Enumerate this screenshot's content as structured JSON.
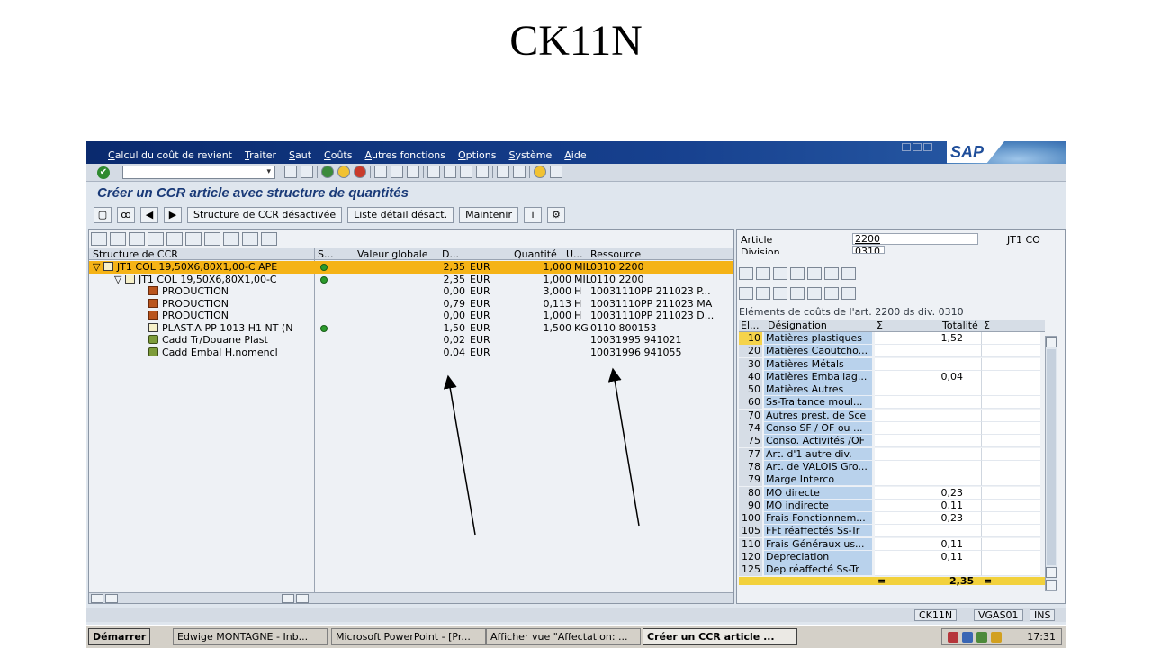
{
  "slide": {
    "title": "CK11N"
  },
  "window": {
    "menu": [
      "Calcul du coût de revient",
      "Traiter",
      "Saut",
      "Coûts",
      "Autres fonctions",
      "Options",
      "Système",
      "Aide"
    ],
    "logo": "SAP"
  },
  "screen_title": "Créer un CCR article avec structure de quantités",
  "app_toolbar": {
    "struct_off": "Structure de CCR désactivée",
    "detail_list_off": "Liste détail désact.",
    "maintain": "Maintenir"
  },
  "tree": {
    "headers": {
      "structure": "Structure de CCR",
      "status": "S...",
      "value": "Valeur globale",
      "currency": "D...",
      "quantity": "Quantité",
      "unit": "U...",
      "resource": "Ressource"
    },
    "rows": [
      {
        "name": "JT1 COL  19,50X6,80X1,00-C  APE",
        "status": true,
        "value": "2,35",
        "cur": "EUR",
        "qty": "1,000",
        "unit": "MIL",
        "res": "0310 2200",
        "level": 0,
        "icon": "assembly",
        "selected": true
      },
      {
        "name": "JT1 COL  19,50X6,80X1,00-C",
        "status": true,
        "value": "2,35",
        "cur": "EUR",
        "qty": "1,000",
        "unit": "MIL",
        "res": "0110 2200",
        "level": 1,
        "icon": "assembly",
        "selected": false
      },
      {
        "name": "PRODUCTION",
        "status": false,
        "value": "0,00",
        "cur": "EUR",
        "qty": "3,000",
        "unit": "H",
        "res": "10031110PP 211023  P...",
        "level": 2,
        "icon": "prod",
        "selected": false
      },
      {
        "name": "PRODUCTION",
        "status": false,
        "value": "0,79",
        "cur": "EUR",
        "qty": "0,113",
        "unit": "H",
        "res": "10031110PP 211023  MA",
        "level": 2,
        "icon": "prod",
        "selected": false
      },
      {
        "name": "PRODUCTION",
        "status": false,
        "value": "0,00",
        "cur": "EUR",
        "qty": "1,000",
        "unit": "H",
        "res": "10031110PP 211023  D...",
        "level": 2,
        "icon": "prod",
        "selected": false
      },
      {
        "name": "PLAST.A PP 1013 H1 NT (N",
        "status": true,
        "value": "1,50",
        "cur": "EUR",
        "qty": "1,500",
        "unit": "KG",
        "res": "0110 800153",
        "level": 2,
        "icon": "assembly",
        "selected": false
      },
      {
        "name": "Cadd Tr/Douane Plast",
        "status": false,
        "value": "0,02",
        "cur": "EUR",
        "qty": "",
        "unit": "",
        "res": "10031995  941021",
        "level": 2,
        "icon": "cadd",
        "selected": false
      },
      {
        "name": "Cadd Embal H.nomencl",
        "status": false,
        "value": "0,04",
        "cur": "EUR",
        "qty": "",
        "unit": "",
        "res": "10031996  941055",
        "level": 2,
        "icon": "cadd",
        "selected": false
      }
    ]
  },
  "right": {
    "article_label": "Article",
    "article_value": "2200",
    "article_desc": "JT1 CO",
    "division_label": "Division",
    "division_value": "0310",
    "caption": "Eléments de coûts de l'art. 2200 ds div. 0310",
    "headers": {
      "el": "El...",
      "des": "Désignation",
      "sigma": "Σ",
      "total": "Totalité",
      "sigma2": "Σ"
    },
    "rows": [
      {
        "code": "10",
        "des": "Matières plastiques",
        "total": "1,52"
      },
      {
        "code": "20",
        "des": "Matières Caoutcho...",
        "total": ""
      },
      {
        "code": "30",
        "des": "Matières Métals",
        "total": ""
      },
      {
        "code": "40",
        "des": "Matières Emballag...",
        "total": "0,04"
      },
      {
        "code": "50",
        "des": "Matières Autres",
        "total": ""
      },
      {
        "code": "60",
        "des": "Ss-Traitance moul...",
        "total": ""
      },
      {
        "code": "70",
        "des": "Autres prest. de Sce",
        "total": ""
      },
      {
        "code": "74",
        "des": "Conso SF / OF ou ...",
        "total": ""
      },
      {
        "code": "75",
        "des": "Conso. Activités /OF",
        "total": ""
      },
      {
        "code": "77",
        "des": "Art. d'1 autre div.",
        "total": ""
      },
      {
        "code": "78",
        "des": "Art. de VALOIS Gro...",
        "total": ""
      },
      {
        "code": "79",
        "des": "Marge Interco",
        "total": ""
      },
      {
        "code": "80",
        "des": "MO directe",
        "total": "0,23"
      },
      {
        "code": "90",
        "des": "MO indirecte",
        "total": "0,11"
      },
      {
        "code": "100",
        "des": "Frais Fonctionnem...",
        "total": "0,23"
      },
      {
        "code": "105",
        "des": "FFt réaffectés Ss-Tr",
        "total": ""
      },
      {
        "code": "110",
        "des": "Frais Généraux us...",
        "total": "0,11"
      },
      {
        "code": "120",
        "des": "Depreciation",
        "total": "0,11"
      },
      {
        "code": "125",
        "des": "Dep réaffecté Ss-Tr",
        "total": ""
      }
    ],
    "total_marker": "=",
    "total_value": "2,35",
    "total_marker2": "="
  },
  "status_bar": {
    "tcode": "CK11N",
    "system": "VGAS01",
    "mode": "INS"
  },
  "taskbar": {
    "start": "Démarrer",
    "tasks": [
      "Edwige MONTAGNE - Inb...",
      "Microsoft PowerPoint - [Pr...",
      "Afficher vue \"Affectation: ...",
      "Créer un CCR article ..."
    ],
    "clock": "17:31"
  },
  "colors": {
    "selected_row": "#f5b316",
    "status_ok": "#2c9b2c",
    "menubar": "#17418f",
    "total_row": "#f2d13c"
  }
}
